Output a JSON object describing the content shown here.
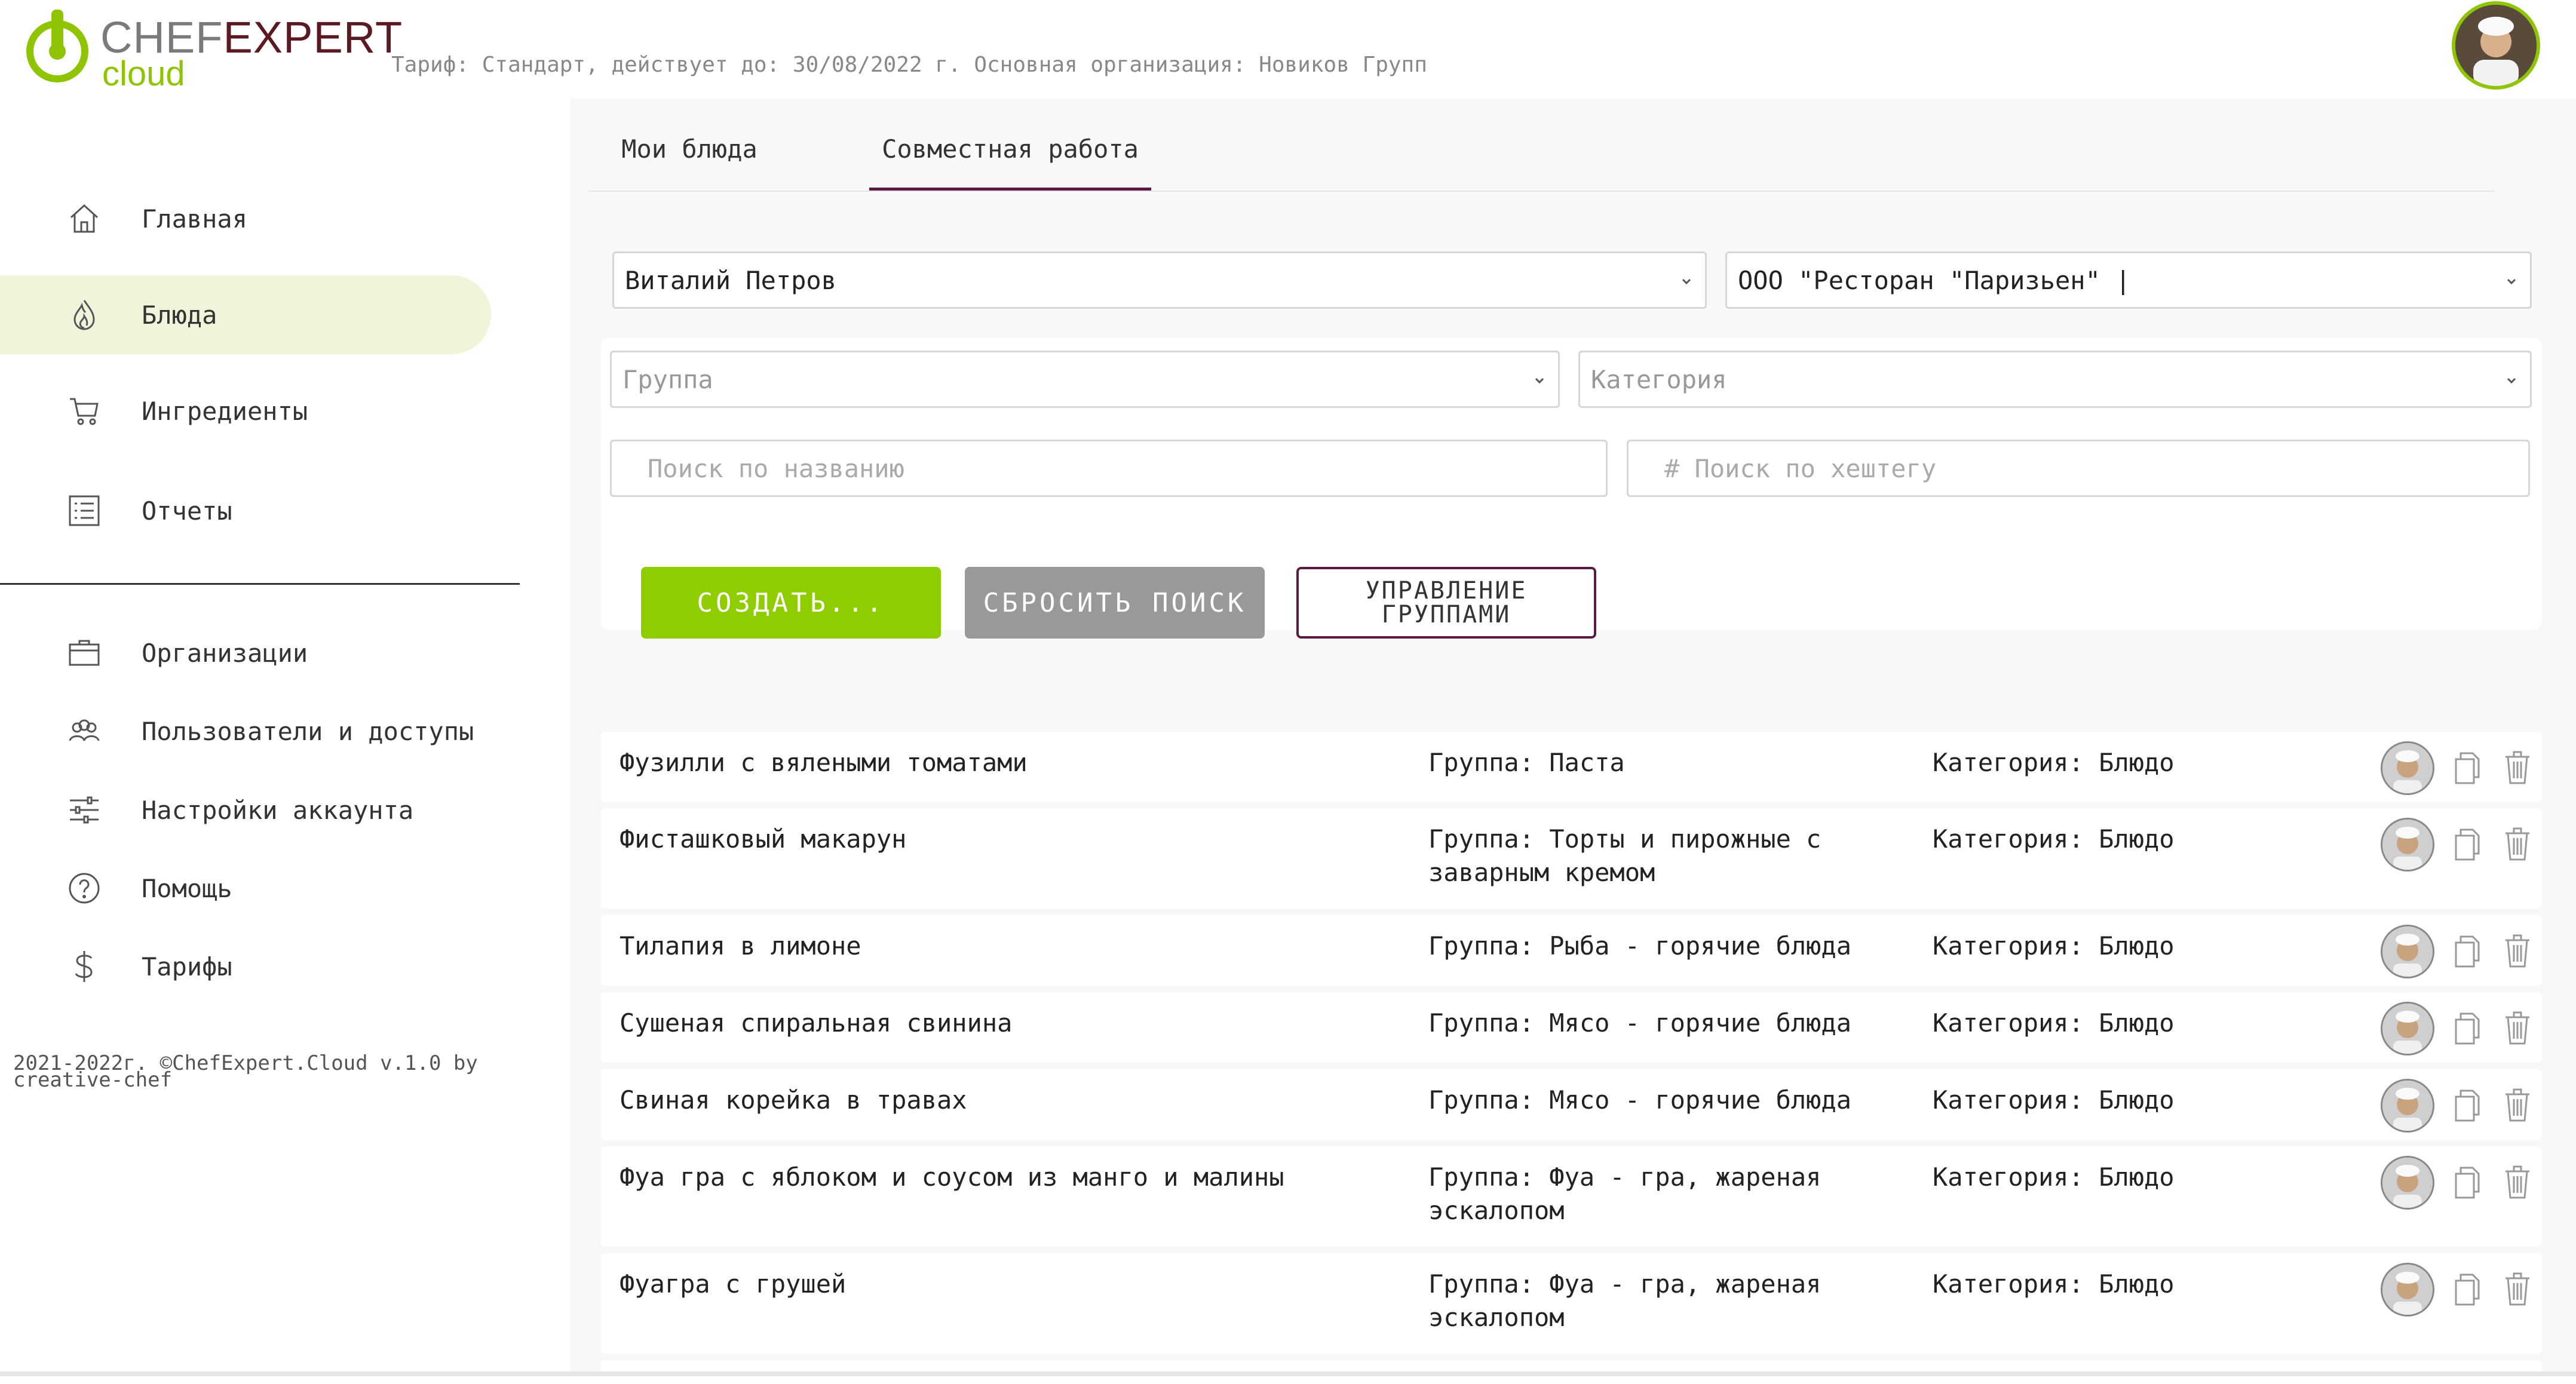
{
  "header": {
    "logo_chef": "CHEF",
    "logo_expert": "EXPERT",
    "logo_cloud": "cloud",
    "tariff_info": "Тариф: Стандарт, действует до: 30/08/2022 г. Основная организация: Новиков Групп"
  },
  "sidebar": {
    "items": [
      {
        "label": "Главная",
        "icon": "home-icon"
      },
      {
        "label": "Блюда",
        "icon": "flame-icon"
      },
      {
        "label": "Ингредиенты",
        "icon": "cart-icon"
      },
      {
        "label": "Отчеты",
        "icon": "list-icon"
      }
    ],
    "items2": [
      {
        "label": "Организации",
        "icon": "briefcase-icon"
      },
      {
        "label": "Пользователи и доступы",
        "icon": "users-icon"
      },
      {
        "label": "Настройки аккаунта",
        "icon": "sliders-icon"
      },
      {
        "label": "Помощь",
        "icon": "help-icon"
      },
      {
        "label": "Тарифы",
        "icon": "dollar-icon"
      }
    ],
    "footer": "2021-2022г. ©ChefExpert.Cloud v.1.0 by creative-chef"
  },
  "tabs": [
    {
      "label": "Мои блюда",
      "active": false
    },
    {
      "label": "Совместная работа",
      "active": true
    }
  ],
  "filters": {
    "user_select": "Виталий Петров",
    "org_select": "ООО \"Ресторан \"Паризьен\" |",
    "group_placeholder": "Группа",
    "category_placeholder": "Категория",
    "search_name_placeholder": "Поиск по названию",
    "search_hashtag_placeholder": "# Поиск по хештегу"
  },
  "buttons": {
    "create": "СОЗДАТЬ...",
    "reset": "СБРОСИТЬ ПОИСК",
    "groups_line1": "УПРАВЛЕНИЕ",
    "groups_line2": "ГРУППАМИ"
  },
  "dishes": [
    {
      "name": "Фузилли с вялеными томатами",
      "group": "Группа: Паста",
      "category": "Категория: Блюдо"
    },
    {
      "name": "Фисташковый макарун",
      "group": "Группа: Торты и пирожные с заварным кремом",
      "category": "Категория: Блюдо"
    },
    {
      "name": "Тилапия в лимоне",
      "group": "Группа: Рыба - горячие блюда",
      "category": "Категория: Блюдо"
    },
    {
      "name": "Сушеная спиральная свинина",
      "group": "Группа: Мясо - горячие блюда",
      "category": "Категория: Блюдо"
    },
    {
      "name": "Свиная корейка в травах",
      "group": "Группа: Мясо - горячие блюда",
      "category": "Категория: Блюдо"
    },
    {
      "name": "Фуа гра с яблоком и соусом из манго и малины",
      "group": "Группа: Фуа - гра, жареная эскалопом",
      "category": "Категория: Блюдо"
    },
    {
      "name": "Фуагра с грушей",
      "group": "Группа: Фуа - гра, жареная эскалопом",
      "category": "Категория: Блюдо"
    }
  ],
  "colors": {
    "accent_green": "#8fcc00",
    "brand_maroon": "#5b1a22",
    "active_nav_bg": "#eef5da"
  }
}
